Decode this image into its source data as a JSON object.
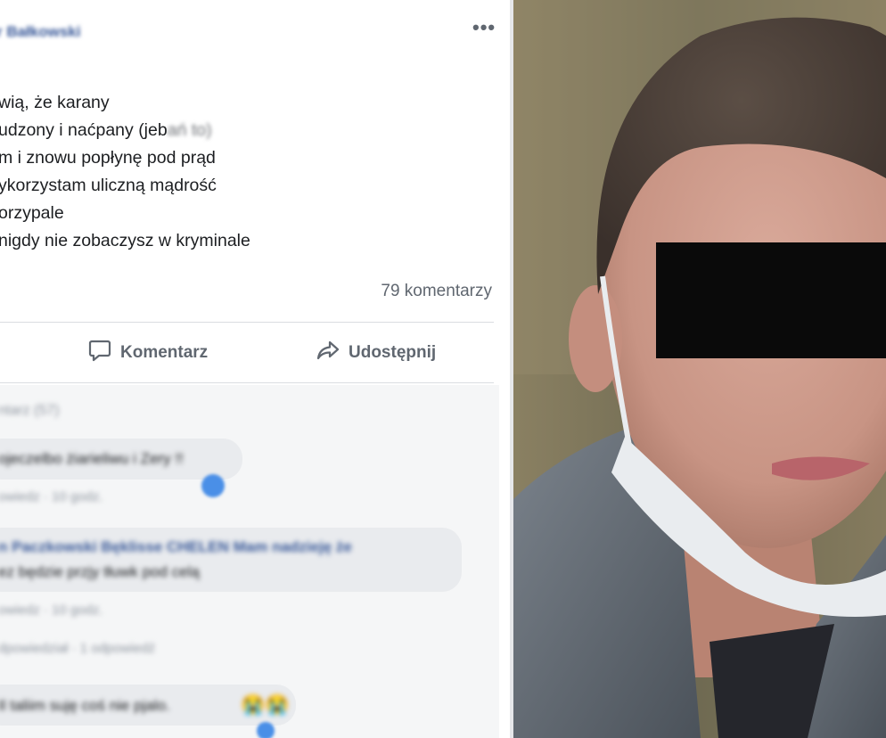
{
  "post": {
    "author_name": "r Bałkowski",
    "more_label": "•••",
    "lines": [
      "wią, że karany",
      "udzony i naćpany (jeb",
      "m i znowu popłynę pod prąd",
      "ykorzystam uliczną mądrość",
      "orzypale",
      "nigdy nie zobaczysz w kryminale"
    ],
    "line2_blurred": "ań to)",
    "comments_count": "79 komentarzy",
    "actions": {
      "comment": "Komentarz",
      "share": "Udostępnij"
    }
  },
  "comments": {
    "more_link": "ntarz (57)",
    "c1_text": "ojeczelbo żiarieliwu i Zery !!",
    "c1_meta": "owiedz · 10 godz.",
    "c2_text": "n Paczkowski Bęklisse CHELEN Mam nadzieję że",
    "c2_text2": "ez będzie przjy tłuwk pod celą",
    "c2_meta": "owiedz · 10 godz.",
    "c2_replies": "dpowiedział · 1 odpowiedź",
    "c3_text": "Il taliim suję coś nie pjalo.",
    "c3_emoji": "😭😭"
  },
  "colors": {
    "link": "#385898",
    "muted": "#606770",
    "text": "#1c1e21",
    "comments_bg": "#f5f6f7",
    "bubble": "#e9ebee",
    "censor_bar": "#0a0a0a"
  }
}
